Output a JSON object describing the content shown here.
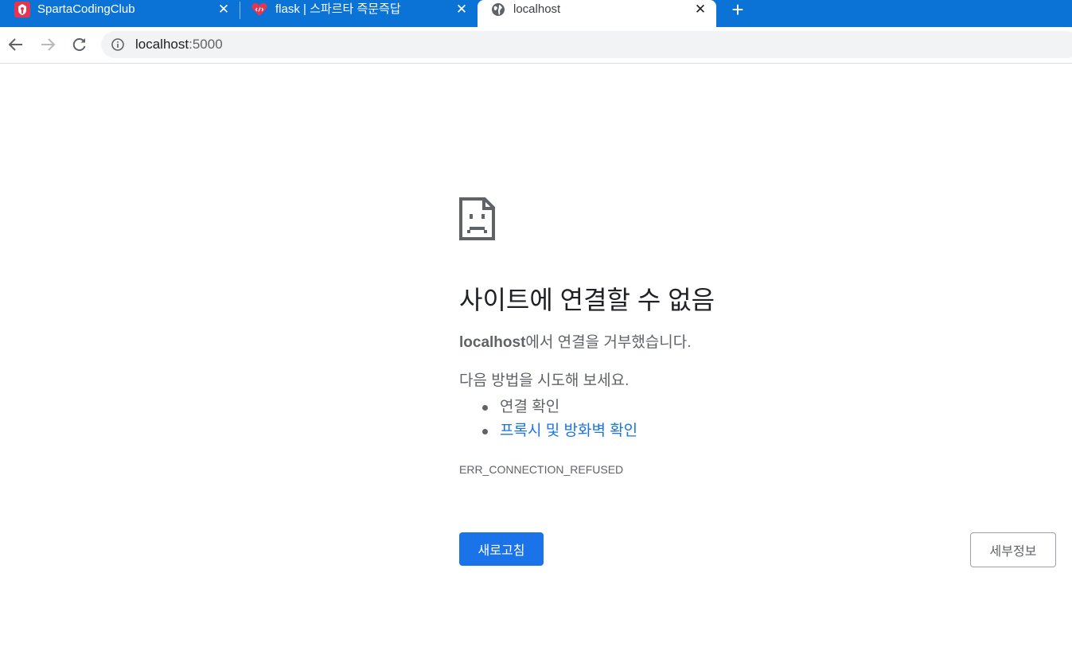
{
  "browser": {
    "tabs": [
      {
        "title": "SpartaCodingClub",
        "favicon": "sparta-logo-icon",
        "active": false
      },
      {
        "title": "flask | 스파르타 즉문즉답",
        "favicon": "heart-code-icon",
        "active": false
      },
      {
        "title": "localhost",
        "favicon": "globe-icon",
        "active": true
      }
    ],
    "close_glyph": "✕",
    "new_tab_glyph": "+",
    "address": {
      "host": "localhost",
      "port": ":5000"
    },
    "colors": {
      "tabstrip": "#0a73d5",
      "accent": "#1a73e8"
    }
  },
  "error_page": {
    "heading": "사이트에 연결할 수 없음",
    "summary_host": "localhost",
    "summary_rest": "에서 연결을 거부했습니다.",
    "suggestions_intro": "다음 방법을 시도해 보세요.",
    "suggestions": [
      {
        "text": "연결 확인",
        "link": false
      },
      {
        "text": "프록시 및 방화벽 확인",
        "link": true
      }
    ],
    "error_code": "ERR_CONNECTION_REFUSED",
    "reload_label": "새로고침",
    "details_label": "세부정보"
  }
}
